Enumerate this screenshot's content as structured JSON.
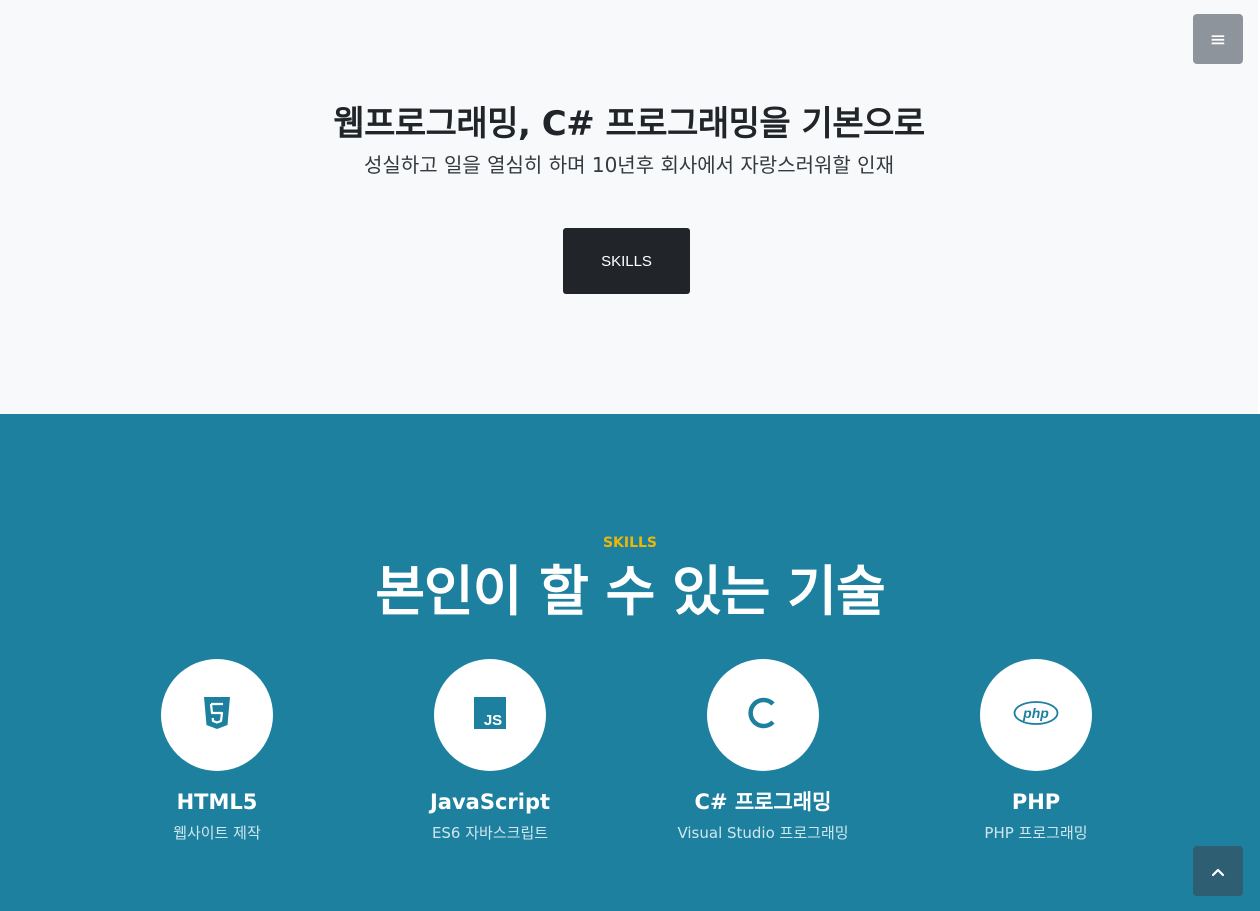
{
  "nav": {
    "menu_icon": "menu-icon",
    "menu_glyph": "≡"
  },
  "hero": {
    "title": "웹프로그래밍, C# 프로그래밍을 기본으로",
    "subtitle": "성실하고 일을 열심히 하며 10년후 회사에서 자랑스러워할 인재",
    "button_label": "SKILLS"
  },
  "skills": {
    "label": "SKILLS",
    "title": "본인이 할 수 있는 기술",
    "items": [
      {
        "icon": "html5-icon",
        "name": "HTML5",
        "desc": "웹사이트 제작"
      },
      {
        "icon": "javascript-icon",
        "name": "JavaScript",
        "desc": "ES6 자바스크립트"
      },
      {
        "icon": "csharp-icon",
        "name": "C# 프로그래밍",
        "desc": "Visual Studio 프로그래밍"
      },
      {
        "icon": "php-icon",
        "name": "PHP",
        "desc": "PHP 프로그래밍"
      }
    ]
  },
  "scroll_top": {
    "icon": "chevron-up-icon"
  },
  "colors": {
    "hero_bg": "#f8f9fa",
    "dark": "#212529",
    "primary": "#1d809f",
    "accent": "#ecb807",
    "menu_bg": "#8e949b",
    "scroll_top_bg": "#2d5e71"
  }
}
